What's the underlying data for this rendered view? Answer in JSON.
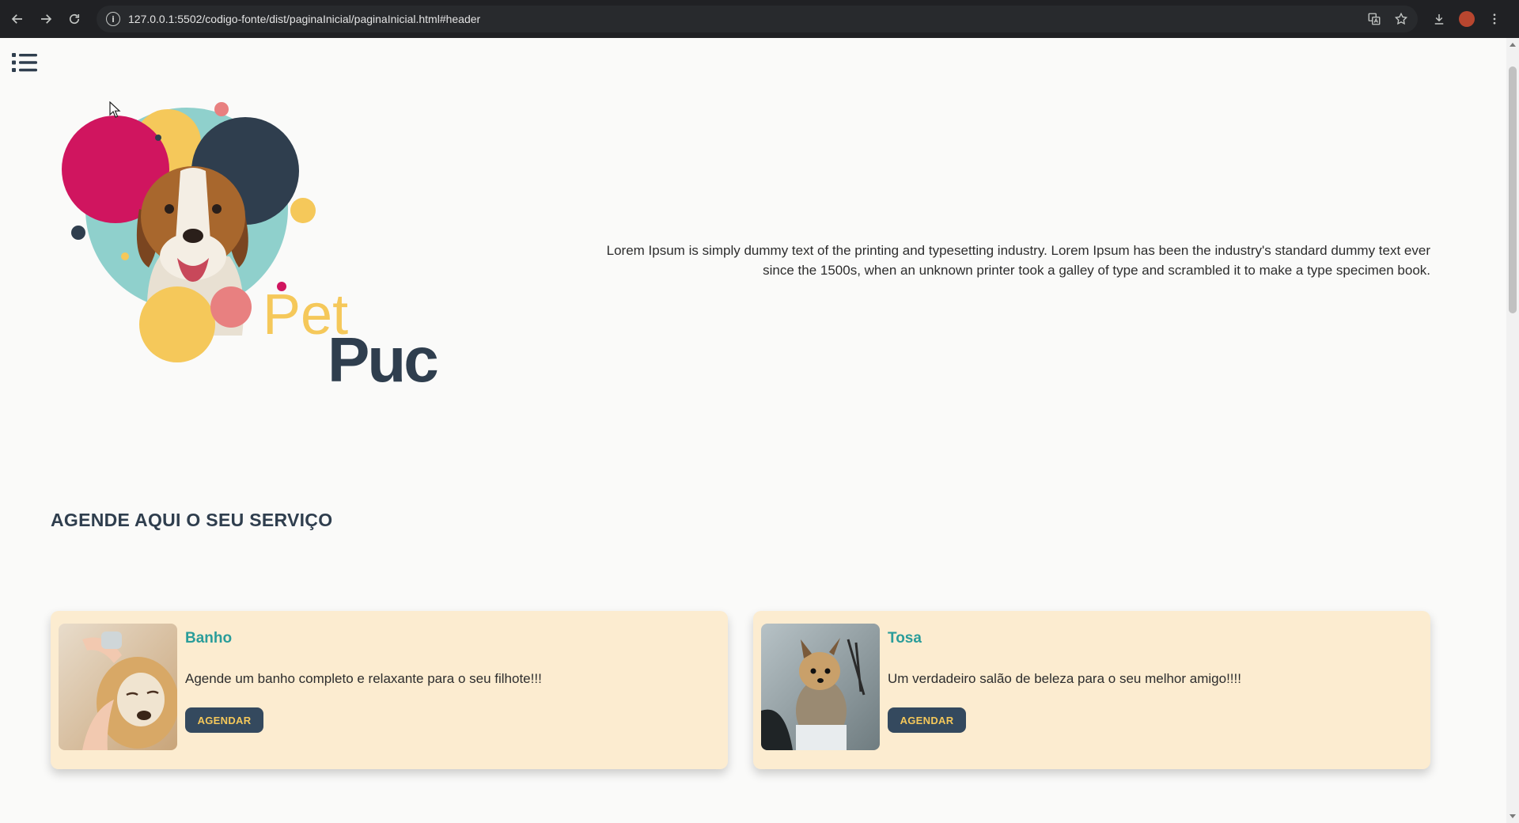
{
  "browser": {
    "url": "127.0.0.1:5502/codigo-fonte/dist/paginaInicial/paginaInicial.html#header"
  },
  "logo": {
    "word1": "Pet",
    "word2": "Puc"
  },
  "intro": {
    "line1": "Lorem Ipsum is simply dummy text of the printing and typesetting industry. Lorem Ipsum has been the industry's standard dummy text ever",
    "line2": "since the 1500s, when an unknown printer took a galley of type and scrambled it to make a type specimen book."
  },
  "services": {
    "title": "AGENDE AQUI O SEU SERVIÇO",
    "cards": [
      {
        "title": "Banho",
        "text": "Agende um banho completo e relaxante para o seu filhote!!!",
        "button": "AGENDAR"
      },
      {
        "title": "Tosa",
        "text": "Um verdadeiro salão de beleza para o seu melhor amigo!!!!",
        "button": "AGENDAR"
      }
    ]
  },
  "colors": {
    "accent_navy": "#34495e",
    "accent_teal": "#2a9d9a",
    "accent_yellow": "#f5c85a",
    "accent_pink": "#d0155f",
    "card_bg": "#fcecd0"
  }
}
